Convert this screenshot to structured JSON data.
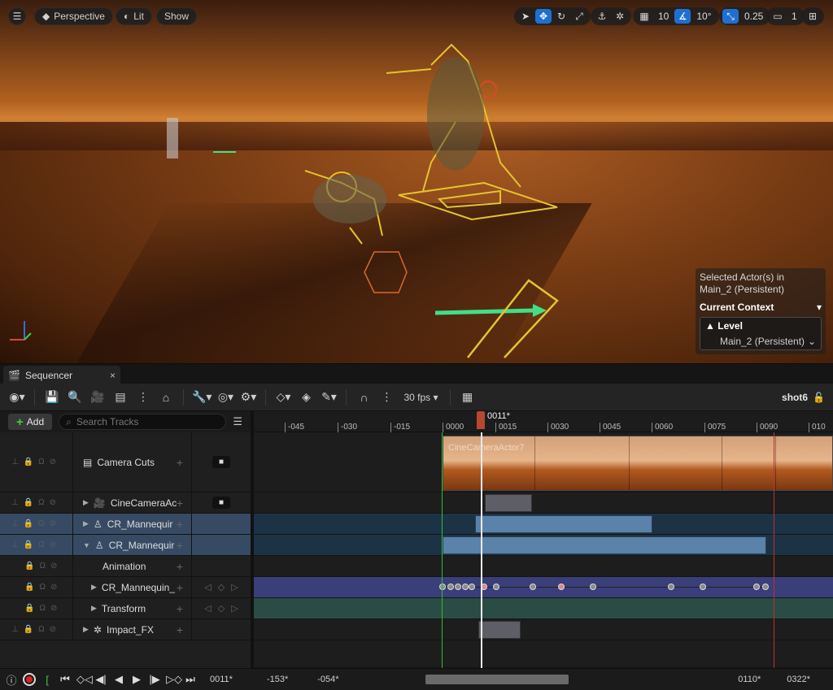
{
  "viewport": {
    "menu_icon": "hamburger-icon",
    "perspective_label": "Perspective",
    "lit_label": "Lit",
    "show_label": "Show",
    "grid_value": "10",
    "angle_value": "10°",
    "scale_value": "0.25",
    "camera_speed_value": "1",
    "context": {
      "selected_actor_line1": "Selected Actor(s) in",
      "selected_actor_line2": "Main_2 (Persistent)",
      "current_context_label": "Current Context",
      "level_label": "Level",
      "level_value": "Main_2 (Persistent)"
    }
  },
  "sequencer": {
    "tab_title": "Sequencer",
    "toolbar": {
      "fps_label": "30 fps",
      "shot_label": "shot6"
    },
    "tree": {
      "add_label": "Add",
      "search_placeholder": "Search Tracks",
      "rows": [
        {
          "label": "Camera Cuts"
        },
        {
          "label": "CineCameraAc"
        },
        {
          "label": "CR_Mannequir"
        },
        {
          "label": "CR_Mannequir"
        },
        {
          "label": "Animation"
        },
        {
          "label": "CR_Mannequin_"
        },
        {
          "label": "Transform"
        },
        {
          "label": "Impact_FX"
        }
      ]
    },
    "ruler": {
      "labels": [
        "-045",
        "-030",
        "-015",
        "0000",
        "0015",
        "0030",
        "0045",
        "0060",
        "0075",
        "0090",
        "010"
      ],
      "playhead_label": "0011*"
    },
    "camera_clip_label": "CineCameraActor7",
    "transport": {
      "current_frame": "0011*",
      "view_start": "-153*",
      "working_start": "-054*",
      "working_end": "0110*",
      "view_end": "0322*"
    }
  }
}
